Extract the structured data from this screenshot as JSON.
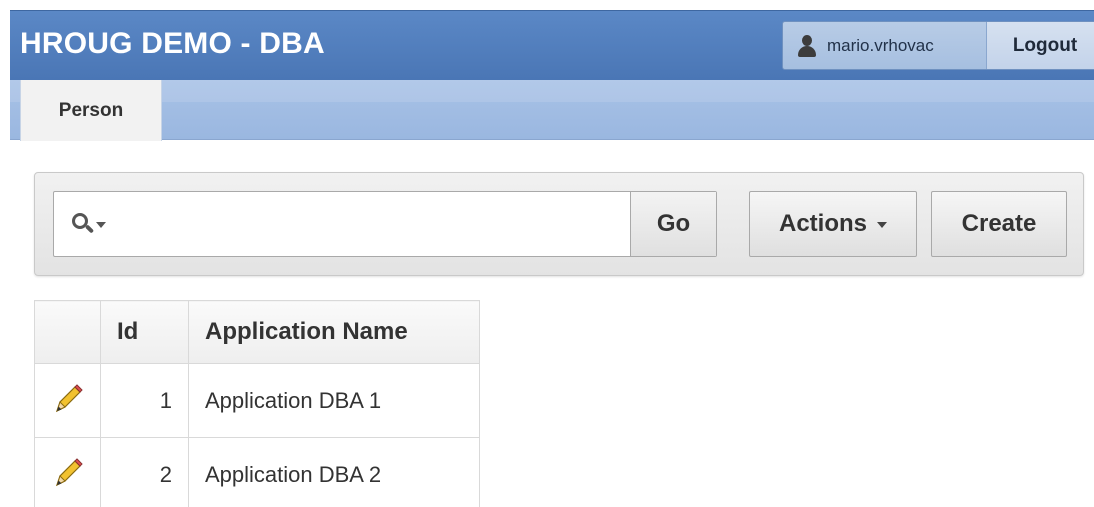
{
  "header": {
    "app_title": "HROUG DEMO - DBA",
    "user_name": "mario.vrhovac",
    "logout_label": "Logout"
  },
  "tabs": [
    {
      "label": "Person",
      "active": true
    }
  ],
  "toolbar": {
    "search_placeholder": "",
    "go_label": "Go",
    "actions_label": "Actions",
    "create_label": "Create"
  },
  "report": {
    "columns": [
      "",
      "Id",
      "Application Name"
    ],
    "rows": [
      {
        "id": "1",
        "name": "Application DBA 1",
        "edit_icon": "pencil-icon"
      },
      {
        "id": "2",
        "name": "Application DBA 2",
        "edit_icon": "pencil-icon"
      }
    ]
  },
  "colors": {
    "header_blue": "#4a76b5",
    "tabbar_blue": "#9ab7e0"
  }
}
